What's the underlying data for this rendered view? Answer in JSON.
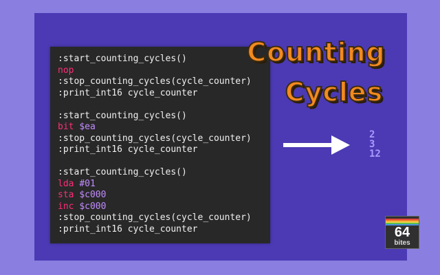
{
  "code_blocks": [
    [
      {
        "parts": [
          {
            "t": ":start_counting_cycles()",
            "c": "plain"
          }
        ]
      },
      {
        "parts": [
          {
            "t": "nop",
            "c": "op"
          }
        ]
      },
      {
        "parts": [
          {
            "t": ":stop_counting_cycles(cycle_counter)",
            "c": "plain"
          }
        ]
      },
      {
        "parts": [
          {
            "t": ":print_int16 cycle_counter",
            "c": "plain"
          }
        ]
      }
    ],
    [
      {
        "parts": [
          {
            "t": ":start_counting_cycles()",
            "c": "plain"
          }
        ]
      },
      {
        "parts": [
          {
            "t": "bit ",
            "c": "op"
          },
          {
            "t": "$ea",
            "c": "arg"
          }
        ]
      },
      {
        "parts": [
          {
            "t": ":stop_counting_cycles(cycle_counter)",
            "c": "plain"
          }
        ]
      },
      {
        "parts": [
          {
            "t": ":print_int16 cycle_counter",
            "c": "plain"
          }
        ]
      }
    ],
    [
      {
        "parts": [
          {
            "t": ":start_counting_cycles()",
            "c": "plain"
          }
        ]
      },
      {
        "parts": [
          {
            "t": "lda ",
            "c": "op"
          },
          {
            "t": "#01",
            "c": "arg"
          }
        ]
      },
      {
        "parts": [
          {
            "t": "sta ",
            "c": "op"
          },
          {
            "t": "$c000",
            "c": "arg"
          }
        ]
      },
      {
        "parts": [
          {
            "t": "inc ",
            "c": "op"
          },
          {
            "t": "$c000",
            "c": "arg"
          }
        ]
      },
      {
        "parts": [
          {
            "t": ":stop_counting_cycles(cycle_counter)",
            "c": "plain"
          }
        ]
      },
      {
        "parts": [
          {
            "t": ":print_int16 cycle_counter",
            "c": "plain"
          }
        ]
      }
    ]
  ],
  "title": {
    "line1": "Counting",
    "line2": "Cycles"
  },
  "output_values": [
    "2",
    "3",
    "12"
  ],
  "logo": {
    "number": "64",
    "text": "bites"
  },
  "colors": {
    "border": "#8a7fe0",
    "screen": "#4b3ab4",
    "code_bg": "#282828",
    "opcode": "#ff2d78",
    "operand": "#c18cff",
    "title": "#f38a1f",
    "output": "#a99bff",
    "logo_stripes": [
      "#e0463c",
      "#f08a2c",
      "#f2d54a",
      "#5fbf4a",
      "#4a8fe0"
    ]
  },
  "icons": {
    "arrow": "arrow-right-icon"
  }
}
